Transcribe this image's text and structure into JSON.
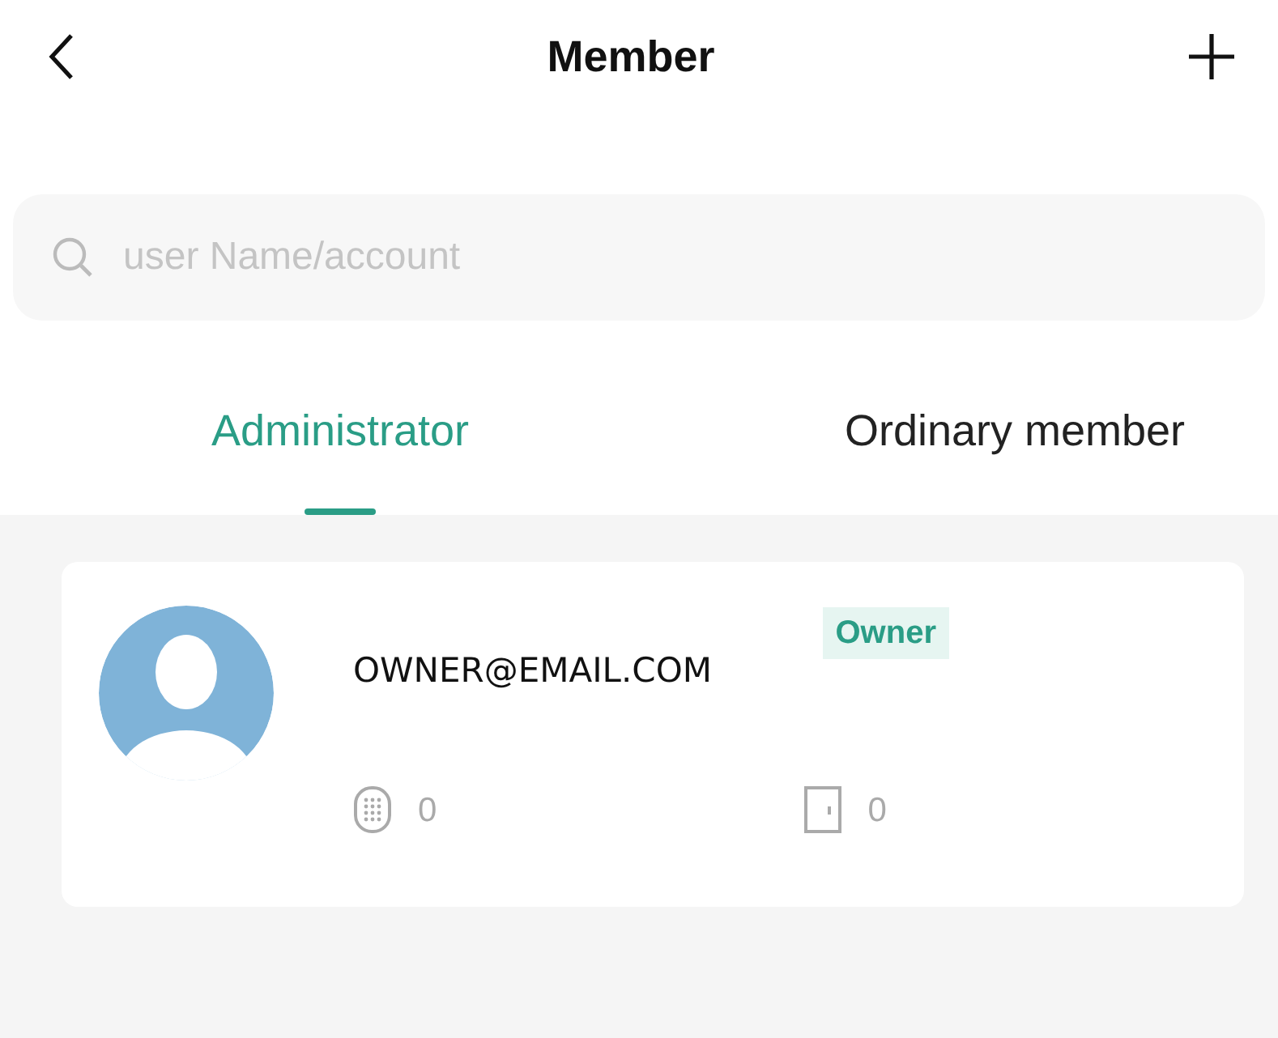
{
  "header": {
    "title": "Member"
  },
  "search": {
    "placeholder": "user Name/account"
  },
  "tabs": [
    {
      "label": "Administrator",
      "selected": true
    },
    {
      "label": "Ordinary member",
      "selected": false
    }
  ],
  "members": [
    {
      "email": "OWNER@EMAIL.COM",
      "role": "Owner",
      "keypad_count": "0",
      "card_count": "0"
    }
  ]
}
